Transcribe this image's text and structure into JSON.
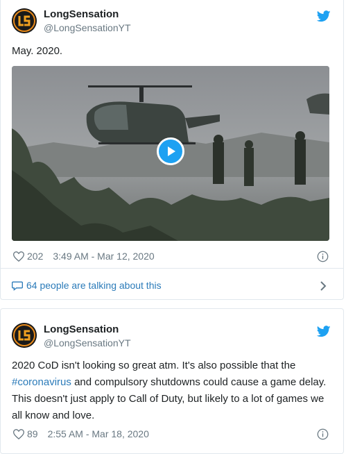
{
  "tweets": [
    {
      "author": {
        "name": "LongSensation",
        "handle": "@LongSensationYT"
      },
      "text": "May. 2020.",
      "likes": "202",
      "timestamp": "3:49 AM - Mar 12, 2020",
      "conversation": "64 people are talking about this"
    },
    {
      "author": {
        "name": "LongSensation",
        "handle": "@LongSensationYT"
      },
      "text_before": "2020 CoD isn't looking so great atm. It's also possible that the",
      "hashtag": "#coronavirus",
      "text_after": "and compulsory shutdowns could cause a game delay. This doesn't just apply to Call of Duty, but likely to a lot of games we all know and love.",
      "likes": "89",
      "timestamp": "2:55 AM - Mar 18, 2020"
    }
  ],
  "colors": {
    "link": "#2b7bb9",
    "twitter_blue": "#1da1f2",
    "muted": "#697882",
    "border": "#e1e8ed"
  },
  "icons": [
    "avatar-ls-logo",
    "twitter-bird-icon",
    "heart-icon",
    "info-icon",
    "speech-bubble-icon",
    "chevron-right-icon",
    "play-icon"
  ]
}
